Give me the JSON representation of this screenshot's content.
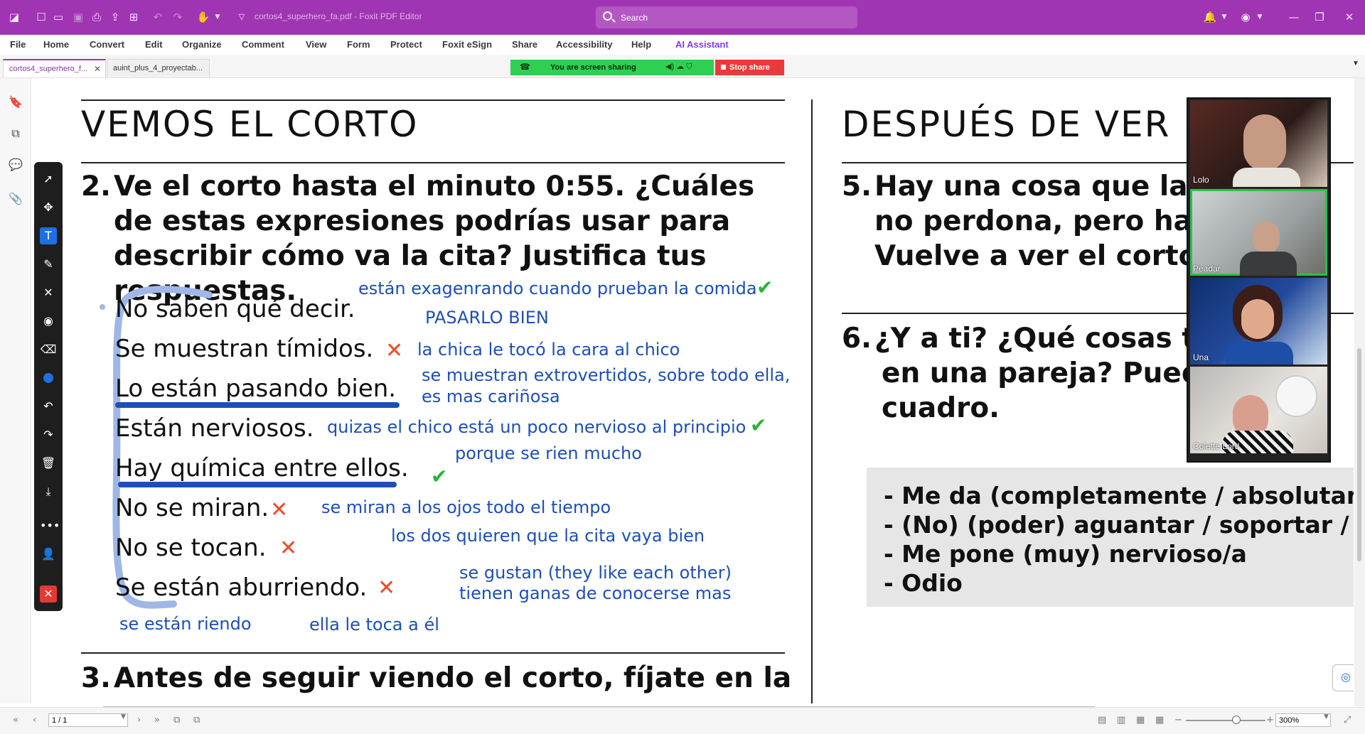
{
  "app": {
    "doc_title": "cortos4_superhero_fa.pdf - Foxit PDF Editor",
    "search_placeholder": "Search"
  },
  "menu": [
    "File",
    "Home",
    "Convert",
    "Edit",
    "Organize",
    "Comment",
    "View",
    "Form",
    "Protect",
    "Foxit eSign",
    "Share",
    "Accessibility",
    "Help",
    "AI Assistant"
  ],
  "tabs": [
    {
      "label": "cortos4_superhero_f...",
      "close": "✕"
    },
    {
      "label": "auint_plus_4_proyectab..."
    }
  ],
  "screen_share": {
    "status": "You are screen sharing",
    "stop_label": "Stop share"
  },
  "left_column": {
    "heading": "VEMOS EL CORTO",
    "q2_number": "2.",
    "q2_text": "Ve el corto hasta el minuto 0:55. ¿Cuáles de estas expresiones podrías usar para describir cómo va la cita? Justifica tus respuestas.",
    "lines": [
      "No saben qué decir.",
      "Se muestran tímidos.",
      "Lo están pasando bien.",
      "Están nerviosos.",
      "Hay química entre ellos.",
      "No se miran.",
      "No se tocan.",
      "Se están aburriendo."
    ],
    "notes": {
      "n1": "están exagenrando cuando prueban la comida",
      "n2": "PASARLO BIEN",
      "n3": "la chica le tocó la cara al chico",
      "n4": "se muestran extrovertidos, sobre todo ella,",
      "n4b": "es mas cariñosa",
      "n5": "quizas el chico está un poco nervioso al principio",
      "n6": "porque se rien mucho",
      "n7": "se miran a los ojos todo el tiempo",
      "n8": "los dos quieren que la cita vaya bien",
      "n9": "se gustan (they like each other)",
      "n9b": "tienen ganas de conocerse mas",
      "n10": "se están riendo",
      "n11": "ella le toca a él"
    },
    "q3_number": "3.",
    "q3_text": "Antes de seguir viendo el corto, fíjate en la"
  },
  "right_column": {
    "heading": "DESPUÉS DE VER E",
    "q5_number": "5.",
    "q5_lines": [
      "Hay una cosa que la pr",
      "no perdona, pero hay c",
      "Vuelve a ver el corto y"
    ],
    "q6_number": "6.",
    "q6_lines": [
      "¿Y a ti? ¿Qué cosas te c",
      "en una pareja?  Puede",
      "cuadro."
    ],
    "box_lines": [
      "- Me da (completamente / absolutamente) i",
      "- (No) (poder) aguantar / soportar / tolerar",
      "- Me pone (muy) nervioso/a",
      "- Odio"
    ]
  },
  "participants": [
    "Lolo",
    "Peadar",
    "Una",
    "Colette Lord"
  ],
  "status": {
    "page": "1 / 1",
    "zoom": "300%"
  },
  "colors": {
    "brand": "#a035b4",
    "ink": "#1d4fb5",
    "share_green": "#2fcf52",
    "stop_red": "#e93a3a"
  }
}
